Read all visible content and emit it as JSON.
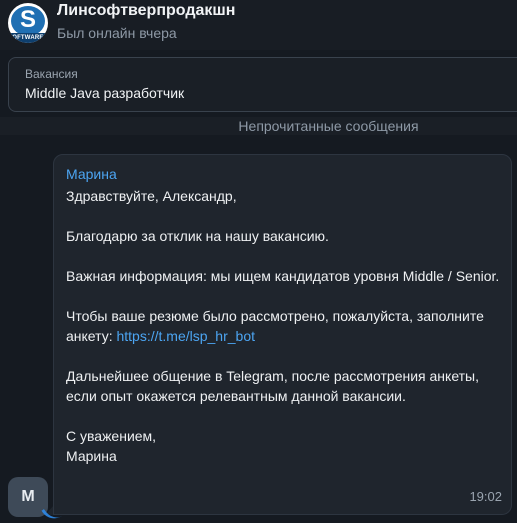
{
  "header": {
    "avatar_letter": "S",
    "avatar_band_text": "SOFTWARE PRO",
    "title": "Линсофтверпродакшн",
    "status": "Был онлайн вчера"
  },
  "vacancy": {
    "label": "Вакансия",
    "value": "Middle Java разработчик"
  },
  "unread_divider": "Непрочитанные сообщения",
  "message": {
    "sender": "Марина",
    "greeting": "Здравствуйте, Александр,",
    "thanks": "Благодарю за отклик на нашу вакансию.",
    "important": "Важная информация: мы ищем кандидатов уровня Middle / Senior.",
    "form_prefix": "Чтобы ваше резюме было рассмотрено, пожалуйста, заполните анкету: ",
    "form_link": "https://t.me/lsp_hr_bot",
    "further": "Дальнейшее общение в Telegram, после рассмотрения анкеты, если опыт окажется релевантным данной вакансии.",
    "regards": "С уважением,",
    "signature": "Марина",
    "time": "19:02"
  },
  "sender_avatar": {
    "letter": "М"
  },
  "colors": {
    "background": "#151a21",
    "bubble": "#1f252d",
    "accent_link": "#4ca5f2",
    "muted_text": "#8e99a6"
  }
}
